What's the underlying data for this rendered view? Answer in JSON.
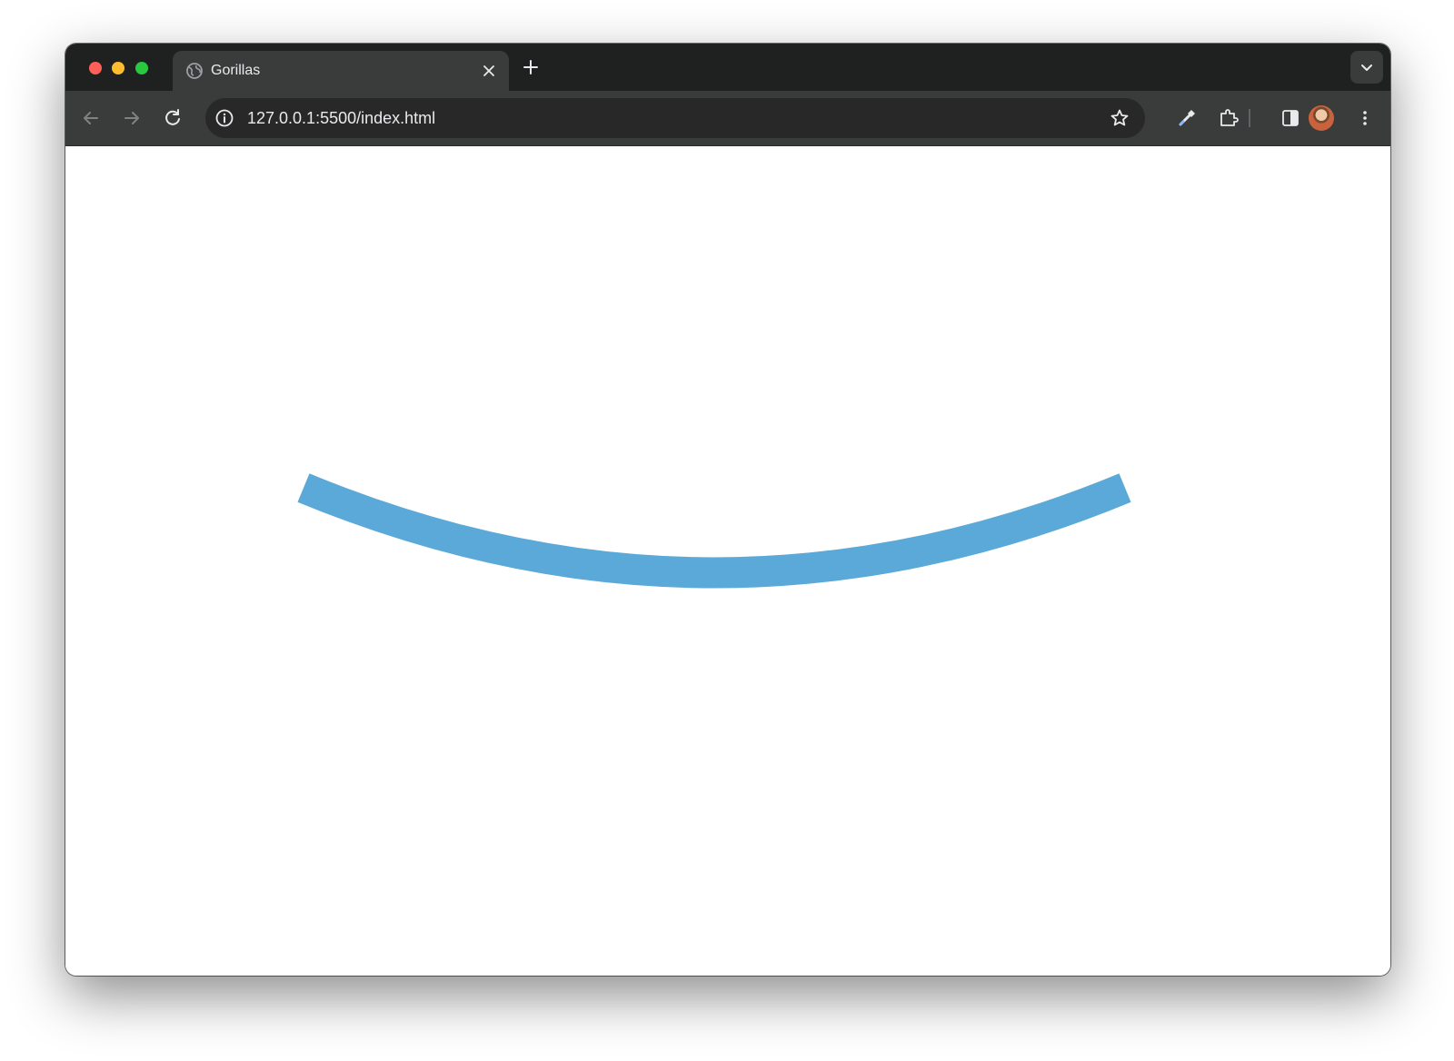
{
  "window": {
    "tab": {
      "title": "Gorillas",
      "favicon": "globe-icon",
      "close_icon": "close-icon"
    },
    "new_tab_icon": "plus-icon",
    "tab_search_icon": "chevron-down-icon"
  },
  "toolbar": {
    "back_icon": "arrow-left-icon",
    "forward_icon": "arrow-right-icon",
    "reload_icon": "reload-icon",
    "omnibox": {
      "site_info_icon": "info-icon",
      "url": "127.0.0.1:5500/index.html",
      "bookmark_icon": "star-icon"
    },
    "extensions": [
      "eyedropper-icon",
      "puzzle-icon"
    ],
    "side_panel_icon": "side-panel-icon",
    "profile_icon": "avatar",
    "menu_icon": "more-vert-icon"
  },
  "page": {
    "arc_color": "#5aa9d8",
    "background": "#ffffff"
  }
}
